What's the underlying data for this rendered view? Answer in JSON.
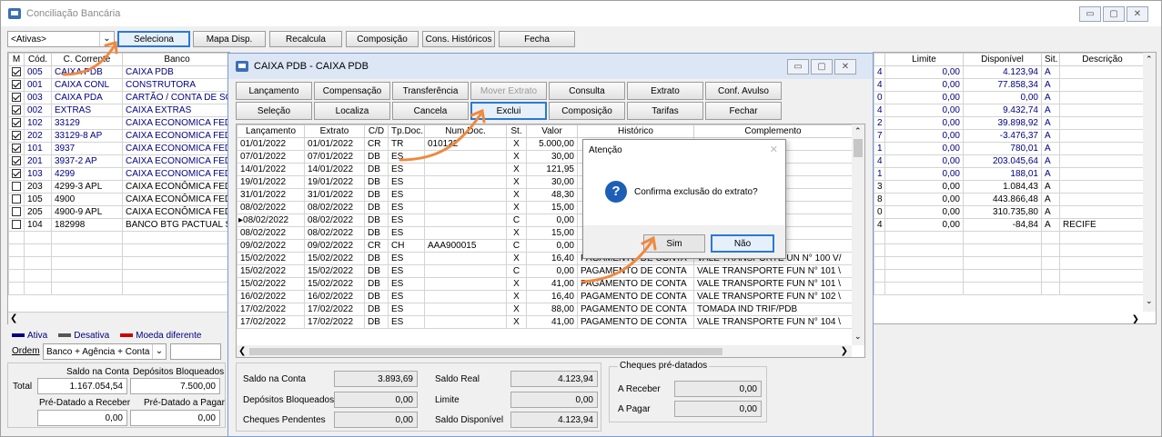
{
  "main": {
    "title": "Conciliação Bancária",
    "filter": "<Ativas>",
    "buttons": [
      "Seleciona",
      "Mapa Disp.",
      "Recalcula",
      "Composição",
      "Cons. Históricos",
      "Fecha"
    ],
    "cols": [
      "M",
      "Cód.",
      "C. Corrente",
      "Banco"
    ],
    "rows": [
      {
        "m": true,
        "cod": "005",
        "cc": "CAIXA PDB",
        "banco": "CAIXA PDB",
        "blue": true
      },
      {
        "m": true,
        "cod": "001",
        "cc": "CAIXA CONL",
        "banco": "CONSTRUTORA",
        "blue": true
      },
      {
        "m": true,
        "cod": "003",
        "cc": "CAIXA PDA",
        "banco": "CARTÃO / CONTA DE SÓ",
        "blue": true
      },
      {
        "m": true,
        "cod": "002",
        "cc": "EXTRAS",
        "banco": "CAIXA EXTRAS",
        "blue": true
      },
      {
        "m": true,
        "cod": "102",
        "cc": "33129",
        "banco": "CAIXA ECONOMICA FEDI",
        "blue": true
      },
      {
        "m": true,
        "cod": "202",
        "cc": "33129-8 AP",
        "banco": "CAIXA ECONOMICA FEDI",
        "blue": true
      },
      {
        "m": true,
        "cod": "101",
        "cc": "3937",
        "banco": "CAIXA ECONOMICA FEDI",
        "blue": true
      },
      {
        "m": true,
        "cod": "201",
        "cc": "3937-2 AP",
        "banco": "CAIXA ECONOMICA FEDI",
        "blue": true
      },
      {
        "m": true,
        "cod": "103",
        "cc": "4299",
        "banco": "CAIXA ECONOMICA FEDI",
        "blue": true
      },
      {
        "m": false,
        "cod": "203",
        "cc": "4299-3 APL",
        "banco": "CAIXA ECONÔMICA FEDI",
        "blue": false
      },
      {
        "m": false,
        "cod": "105",
        "cc": "4900",
        "banco": "CAIXA ECONÔMICA FEDI",
        "blue": false
      },
      {
        "m": false,
        "cod": "205",
        "cc": "4900-9 APL",
        "banco": "CAIXA ECONÔMICA FEDI",
        "blue": false
      },
      {
        "m": false,
        "cod": "104",
        "cc": "182998",
        "banco": "BANCO BTG PACTUAL S",
        "blue": false
      }
    ],
    "rcols": [
      "Limite",
      "Disponível",
      "Sit.",
      "Descrição"
    ],
    "rrows": [
      {
        "lim": "0,00",
        "disp": "4.123,94",
        "sit": "A",
        "desc": "",
        "blue": true,
        "e": "4"
      },
      {
        "lim": "0,00",
        "disp": "77.858,34",
        "sit": "A",
        "desc": "",
        "blue": true,
        "e": "4"
      },
      {
        "lim": "0,00",
        "disp": "0,00",
        "sit": "A",
        "desc": "",
        "blue": true,
        "e": "0"
      },
      {
        "lim": "0,00",
        "disp": "9.432,74",
        "sit": "A",
        "desc": "",
        "blue": true,
        "e": "4"
      },
      {
        "lim": "0,00",
        "disp": "39.898,92",
        "sit": "A",
        "desc": "",
        "blue": true,
        "e": "2"
      },
      {
        "lim": "0,00",
        "disp": "-3.476,37",
        "sit": "A",
        "desc": "",
        "blue": true,
        "e": "7"
      },
      {
        "lim": "0,00",
        "disp": "780,01",
        "sit": "A",
        "desc": "",
        "blue": true,
        "e": "1"
      },
      {
        "lim": "0,00",
        "disp": "203.045,64",
        "sit": "A",
        "desc": "",
        "blue": true,
        "e": "4"
      },
      {
        "lim": "0,00",
        "disp": "188,01",
        "sit": "A",
        "desc": "",
        "blue": true,
        "e": "1"
      },
      {
        "lim": "0,00",
        "disp": "1.084,43",
        "sit": "A",
        "desc": "",
        "blue": false,
        "e": "3"
      },
      {
        "lim": "0,00",
        "disp": "443.866,48",
        "sit": "A",
        "desc": "",
        "blue": false,
        "e": "8"
      },
      {
        "lim": "0,00",
        "disp": "310.735,80",
        "sit": "A",
        "desc": "",
        "blue": false,
        "e": "0"
      },
      {
        "lim": "0,00",
        "disp": "-84,84",
        "sit": "A",
        "desc": "RECIFE",
        "blue": false,
        "e": "4"
      }
    ],
    "legend": [
      "Ativa",
      "Desativa",
      "Moeda diferente"
    ],
    "ordem_label": "Ordem",
    "ordem_value": "Banco + Agência + Conta",
    "saldo_conta_label": "Saldo na Conta",
    "dep_bloq_label": "Depósitos Bloqueados",
    "total_label": "Total",
    "saldo_total": "1.167.054,54",
    "dep_total": "7.500,00",
    "pre_receber_label": "Pré-Datado a Receber",
    "pre_pagar_label": "Pré-Datado a Pagar",
    "pre_receber": "0,00",
    "pre_pagar": "0,00"
  },
  "child": {
    "title": "CAIXA PDB  -  CAIXA PDB",
    "row1": [
      "Lançamento",
      "Compensação",
      "Transferência",
      "Mover Extrato",
      "Consulta",
      "Extrato",
      "Conf. Avulso"
    ],
    "row2": [
      "Seleção",
      "Localiza",
      "Cancela",
      "Exclui",
      "Composição",
      "Tarifas",
      "Fechar"
    ],
    "cols": [
      "Lançamento",
      "Extrato",
      "C/D",
      "Tp.Doc.",
      "Num.Doc.",
      "St.",
      "Valor",
      "Histórico",
      "Complemento"
    ],
    "rows": [
      {
        "l": "01/01/2022",
        "e": "01/01/2022",
        "cd": "CR",
        "tp": "TR",
        "num": "010122",
        "st": "X",
        "v": "5.000,00",
        "h": "",
        "c": "AIXA PDB"
      },
      {
        "l": "07/01/2022",
        "e": "07/01/2022",
        "cd": "DB",
        "tp": "ES",
        "num": "",
        "st": "X",
        "v": "30,00",
        "h": "",
        "c": "PDB CABO CON"
      },
      {
        "l": "14/01/2022",
        "e": "14/01/2022",
        "cd": "DB",
        "tp": "ES",
        "num": "",
        "st": "X",
        "v": "121,95",
        "h": "",
        "c": "PEZA OBRA PDE"
      },
      {
        "l": "19/01/2022",
        "e": "19/01/2022",
        "cd": "DB",
        "tp": "ES",
        "num": "",
        "st": "X",
        "v": "30,00",
        "h": "",
        "c": "E FUNC. 95 E 9"
      },
      {
        "l": "31/01/2022",
        "e": "31/01/2022",
        "cd": "DB",
        "tp": "ES",
        "num": "",
        "st": "X",
        "v": "48,30",
        "h": "",
        "c": "PDB TOMADA IN"
      },
      {
        "l": "08/02/2022",
        "e": "08/02/2022",
        "cd": "DB",
        "tp": "ES",
        "num": "",
        "st": "X",
        "v": "15,00",
        "h": "",
        "c": "E FUNC. 98 VA"
      },
      {
        "l": "08/02/2022",
        "e": "08/02/2022",
        "cd": "DB",
        "tp": "ES",
        "num": "",
        "st": "C",
        "v": "0,00",
        "h": "",
        "c": "E FUN N° 99 V/"
      },
      {
        "l": "08/02/2022",
        "e": "08/02/2022",
        "cd": "DB",
        "tp": "ES",
        "num": "",
        "st": "X",
        "v": "15,00",
        "h": "",
        "c": "E FUN N° 99 V/"
      },
      {
        "l": "09/02/2022",
        "e": "09/02/2022",
        "cd": "CR",
        "tp": "CH",
        "num": "AAA900015",
        "st": "C",
        "v": "0,00",
        "h": "",
        "c": "E DESPESAS"
      },
      {
        "l": "15/02/2022",
        "e": "15/02/2022",
        "cd": "DB",
        "tp": "ES",
        "num": "",
        "st": "X",
        "v": "16,40",
        "h": "PAGAMENTO DE CONTA",
        "c": "VALE TRANSPORTE UN N° 100 V/"
      },
      {
        "l": "15/02/2022",
        "e": "15/02/2022",
        "cd": "DB",
        "tp": "ES",
        "num": "",
        "st": "C",
        "v": "0,00",
        "h": "PAGAMENTO DE CONTA",
        "c": "VALE TRANSPORTE FUN N° 101 \\"
      },
      {
        "l": "15/02/2022",
        "e": "15/02/2022",
        "cd": "DB",
        "tp": "ES",
        "num": "",
        "st": "X",
        "v": "41,00",
        "h": "PAGAMENTO DE CONTA",
        "c": "VALE TRANSPORTE FUN N° 101 \\"
      },
      {
        "l": "16/02/2022",
        "e": "16/02/2022",
        "cd": "DB",
        "tp": "ES",
        "num": "",
        "st": "X",
        "v": "16,40",
        "h": "PAGAMENTO DE CONTA",
        "c": "VALE TRANSPORTE FUN N° 102 \\"
      },
      {
        "l": "17/02/2022",
        "e": "17/02/2022",
        "cd": "DB",
        "tp": "ES",
        "num": "",
        "st": "X",
        "v": "88,00",
        "h": "PAGAMENTO DE CONTA",
        "c": "TOMADA IND TRIF/PDB"
      },
      {
        "l": "17/02/2022",
        "e": "17/02/2022",
        "cd": "DB",
        "tp": "ES",
        "num": "",
        "st": "X",
        "v": "41,00",
        "h": "PAGAMENTO DE CONTA",
        "c": "VALE TRANSPORTE FUN N° 104 \\"
      }
    ],
    "saldo_conta_label": "Saldo na Conta",
    "saldo_conta": "3.893,69",
    "dep_bloq_label": "Depósitos Bloqueados",
    "dep_bloq": "0,00",
    "cheq_pend_label": "Cheques Pendentes",
    "cheq_pend": "0,00",
    "saldo_real_label": "Saldo Real",
    "saldo_real": "4.123,94",
    "limite_label": "Limite",
    "limite": "0,00",
    "saldo_disp_label": "Saldo Disponível",
    "saldo_disp": "4.123,94",
    "cheques_group": "Cheques pré-datados",
    "a_receber_label": "A Receber",
    "a_receber": "0,00",
    "a_pagar_label": "A Pagar",
    "a_pagar": "0,00"
  },
  "dialog": {
    "title": "Atenção",
    "message": "Confirma exclusão do extrato?",
    "yes": "Sim",
    "no": "Não"
  }
}
